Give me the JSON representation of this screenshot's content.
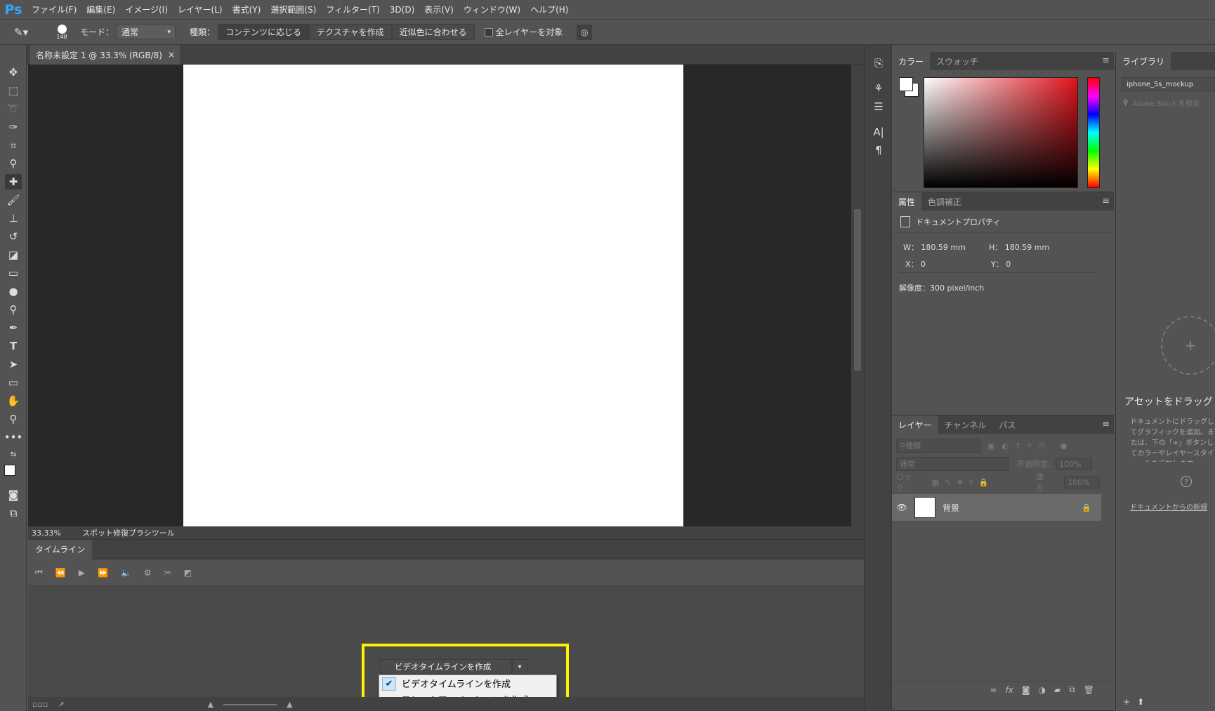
{
  "menu": {
    "logo": "Ps",
    "items": [
      "ファイル(F)",
      "編集(E)",
      "イメージ(I)",
      "レイヤー(L)",
      "書式(Y)",
      "選択範囲(S)",
      "フィルター(T)",
      "3D(D)",
      "表示(V)",
      "ウィンドウ(W)",
      "ヘルプ(H)"
    ]
  },
  "options": {
    "brush_size": "148",
    "mode_label": "モード：",
    "mode_value": "通常",
    "type_label": "種類：",
    "type_buttons": [
      "コンテンツに応じる",
      "テクスチャを作成",
      "近似色に合わせる"
    ],
    "sample_all_layers": "全レイヤーを対象"
  },
  "document": {
    "tab_title": "名称未設定 1 @ 33.3% (RGB/8)",
    "close": "×",
    "zoom": "33.33%",
    "tool_status": "スポット修復ブラシツール"
  },
  "timeline": {
    "tab_label": "タイムライン",
    "dropdown_label": "ビデオタイムラインを作成",
    "options": [
      "ビデオタイムラインを作成",
      "フレームアニメーションを作成"
    ],
    "selected_index": 0
  },
  "color_panel": {
    "tabs": [
      "カラー",
      "スウォッチ"
    ]
  },
  "properties_panel": {
    "tabs": [
      "属性",
      "色調補正"
    ],
    "header": "ドキュメントプロパティ",
    "w": "W： 180.59 mm",
    "h": "H： 180.59 mm",
    "x": "X： 0",
    "y": "Y： 0",
    "resolution": "解像度：300 pixel/inch"
  },
  "layers_panel": {
    "tabs": [
      "レイヤー",
      "チャンネル",
      "パス"
    ],
    "filter_placeholder": "種類",
    "blend_mode": "通常",
    "opacity_label": "不透明度：",
    "opacity_value": "100%",
    "lock_label": "ロック：",
    "fill_label": "塗り：",
    "fill_value": "100%",
    "layers": [
      {
        "name": "背景",
        "visible": true,
        "locked": true
      }
    ]
  },
  "libraries_panel": {
    "tab": "ライブラリ",
    "library_name": "iphone_5s_mockup",
    "search_placeholder": "Adobe Stock を検索",
    "drag_title": "アセットをドラッグ",
    "drag_desc": "ドキュメントにドラッグしてグラフィックを追加。または、下の「+」ボタンしてカラーやレイヤースタイルを追加します。",
    "link": "ドキュメントからの新規"
  },
  "colors": {
    "highlight": "#fff200",
    "ps_blue": "#31a8ff"
  }
}
